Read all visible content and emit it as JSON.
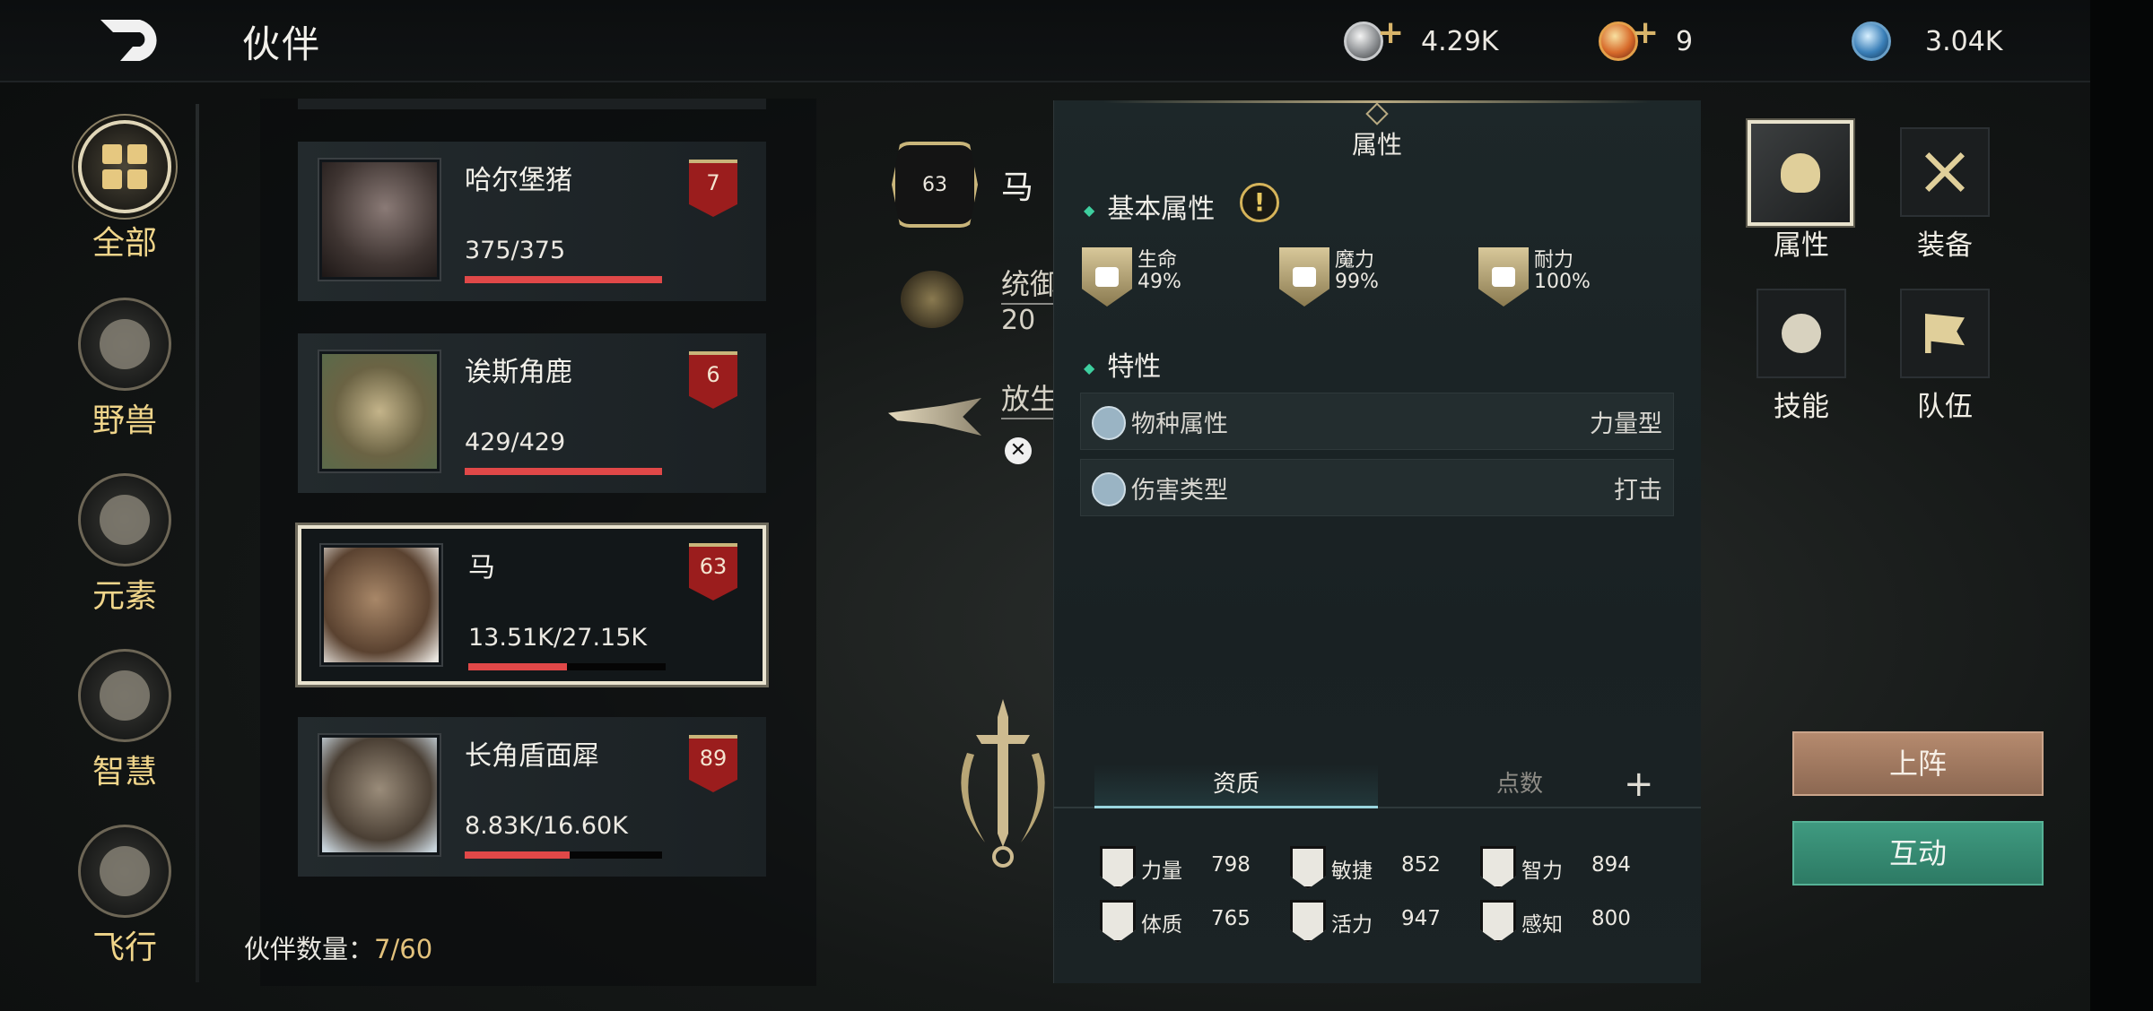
{
  "header": {
    "title": "伙伴",
    "currencies": [
      {
        "name": "silver-coin-icon",
        "value": "4.29K",
        "has_add": true
      },
      {
        "name": "gold-token-icon",
        "value": "9",
        "has_add": true
      },
      {
        "name": "blue-gem-icon",
        "value": "3.04K",
        "has_add": false
      }
    ]
  },
  "categories": [
    {
      "label": "全部",
      "icon": "grid-icon",
      "active": true
    },
    {
      "label": "野兽",
      "icon": "beast-icon",
      "active": false
    },
    {
      "label": "元素",
      "icon": "element-icon",
      "active": false
    },
    {
      "label": "智慧",
      "icon": "wisdom-icon",
      "active": false
    },
    {
      "label": "飞行",
      "icon": "flight-icon",
      "active": false
    }
  ],
  "companions": [
    {
      "name": "哈尔堡猪",
      "hp": "375/375",
      "hp_ratio": 1.0,
      "level": "7",
      "selected": false
    },
    {
      "name": "诶斯角鹿",
      "hp": "429/429",
      "hp_ratio": 1.0,
      "level": "6",
      "selected": false
    },
    {
      "name": "马",
      "hp": "13.51K/27.15K",
      "hp_ratio": 0.5,
      "level": "63",
      "selected": true
    },
    {
      "name": "长角盾面犀",
      "hp": "8.83K/16.60K",
      "hp_ratio": 0.53,
      "level": "89",
      "selected": false
    }
  ],
  "companion_count": {
    "label": "伙伴数量：",
    "value": "7/60"
  },
  "detail": {
    "level": "63",
    "name": "马",
    "leadership_label": "统御值",
    "leadership_value": "20",
    "herd_label": "放生"
  },
  "attributes": {
    "title": "属性",
    "basic_title": "基本属性",
    "basic": [
      {
        "name": "生命",
        "value": "49%",
        "icon": "heart-icon"
      },
      {
        "name": "魔力",
        "value": "99%",
        "icon": "book-icon"
      },
      {
        "name": "耐力",
        "value": "100%",
        "icon": "stamina-icon"
      }
    ],
    "traits_title": "特性",
    "traits": [
      {
        "name": "物种属性",
        "value": "力量型",
        "icon": "paw-icon"
      },
      {
        "name": "伤害类型",
        "value": "打击",
        "icon": "swords-icon"
      }
    ],
    "tabs": {
      "aptitude": "资质",
      "points": "点数"
    },
    "aptitudes": [
      {
        "name": "力量",
        "value": "798",
        "icon": "strength-icon"
      },
      {
        "name": "敏捷",
        "value": "852",
        "icon": "agility-icon"
      },
      {
        "name": "智力",
        "value": "894",
        "icon": "intellect-icon"
      },
      {
        "name": "体质",
        "value": "765",
        "icon": "constitution-icon"
      },
      {
        "name": "活力",
        "value": "947",
        "icon": "vitality-icon"
      },
      {
        "name": "感知",
        "value": "800",
        "icon": "perception-icon"
      }
    ]
  },
  "side_menu": [
    {
      "label": "属性",
      "icon": "flame-icon",
      "active": true
    },
    {
      "label": "装备",
      "icon": "crossed-swords-icon",
      "active": false
    },
    {
      "label": "技能",
      "icon": "skill-icon",
      "active": false
    },
    {
      "label": "队伍",
      "icon": "flag-icon",
      "active": false
    }
  ],
  "actions": {
    "deploy": "上阵",
    "interact": "互动"
  },
  "colors": {
    "accent_gold": "#e3c27c",
    "hp_red": "#e04848",
    "teal": "#3ecf9f",
    "deploy": "#a57a60",
    "interact": "#358a72"
  }
}
